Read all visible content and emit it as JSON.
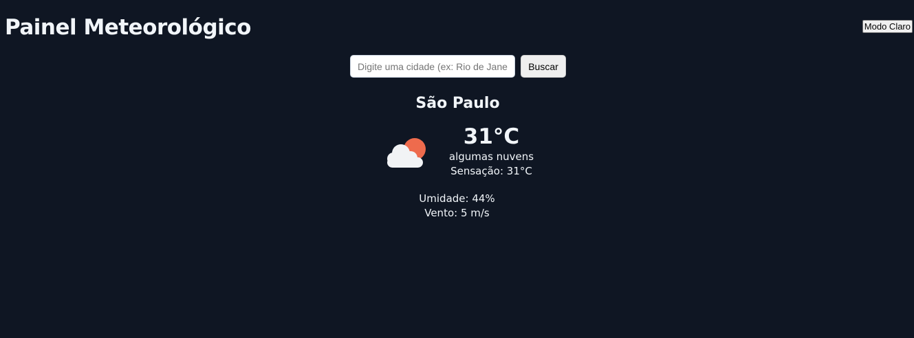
{
  "header": {
    "title": "Painel Meteorológico",
    "theme_toggle_label": "Modo Claro"
  },
  "search": {
    "placeholder": "Digite uma cidade (ex: Rio de Janeiro)",
    "value": "",
    "button_label": "Buscar"
  },
  "weather": {
    "city": "São Paulo",
    "icon": "partly-cloudy-icon",
    "temperature": "31°C",
    "description": "algumas nuvens",
    "feels_like": "Sensação: 31°C",
    "humidity": "Umidade: 44%",
    "wind": "Vento: 5 m/s"
  },
  "colors": {
    "background": "#0f1623",
    "text": "#f1f5f9",
    "sun": "#ee6b4d",
    "cloud": "#f1f3f5"
  }
}
